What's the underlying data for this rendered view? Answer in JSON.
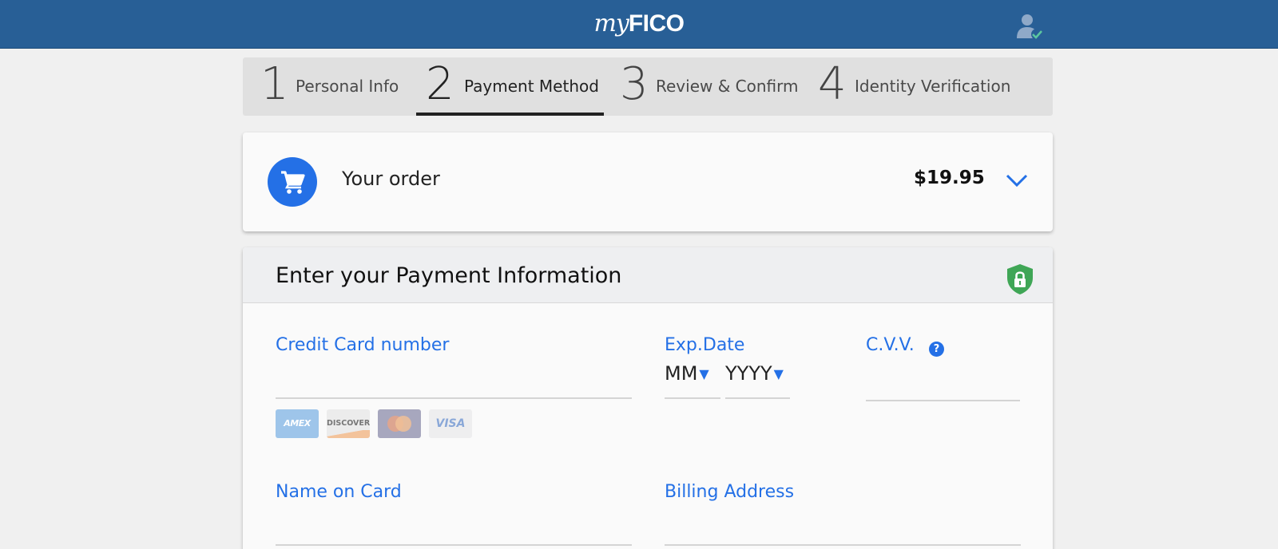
{
  "header": {
    "logo_my": "my",
    "logo_fico": "FICO",
    "user_icon": "user-check-icon",
    "bg_color": "#285f96"
  },
  "steps": [
    {
      "number": "1",
      "label": "Personal Info",
      "active": false
    },
    {
      "number": "2",
      "label": "Payment Method",
      "active": true
    },
    {
      "number": "3",
      "label": "Review & Confirm",
      "active": false
    },
    {
      "number": "4",
      "label": "Identity Verification",
      "active": false
    }
  ],
  "order": {
    "title": "Your order",
    "price": "$19.95",
    "icon": "shopping-cart-icon",
    "toggle_icon": "chevron-down-icon"
  },
  "payment": {
    "title": "Enter your Payment Information",
    "secure_icon": "lock-shield-icon",
    "card_number_label": "Credit Card number",
    "card_number_value": "",
    "exp_label": "Exp.Date",
    "exp_month": "MM",
    "exp_year": "YYYY",
    "cvv_label": "C.V.V.",
    "cvv_help": "?",
    "cvv_value": "",
    "accepted_cards": [
      "AMEX",
      "DISCOVER",
      "mastercard",
      "VISA"
    ],
    "name_label": "Name on Card",
    "name_value": "",
    "billing_label": "Billing Address",
    "billing_value": ""
  },
  "colors": {
    "accent": "#2470e6",
    "secure_green": "#3fa656",
    "page_bg": "#f0f0f0"
  }
}
